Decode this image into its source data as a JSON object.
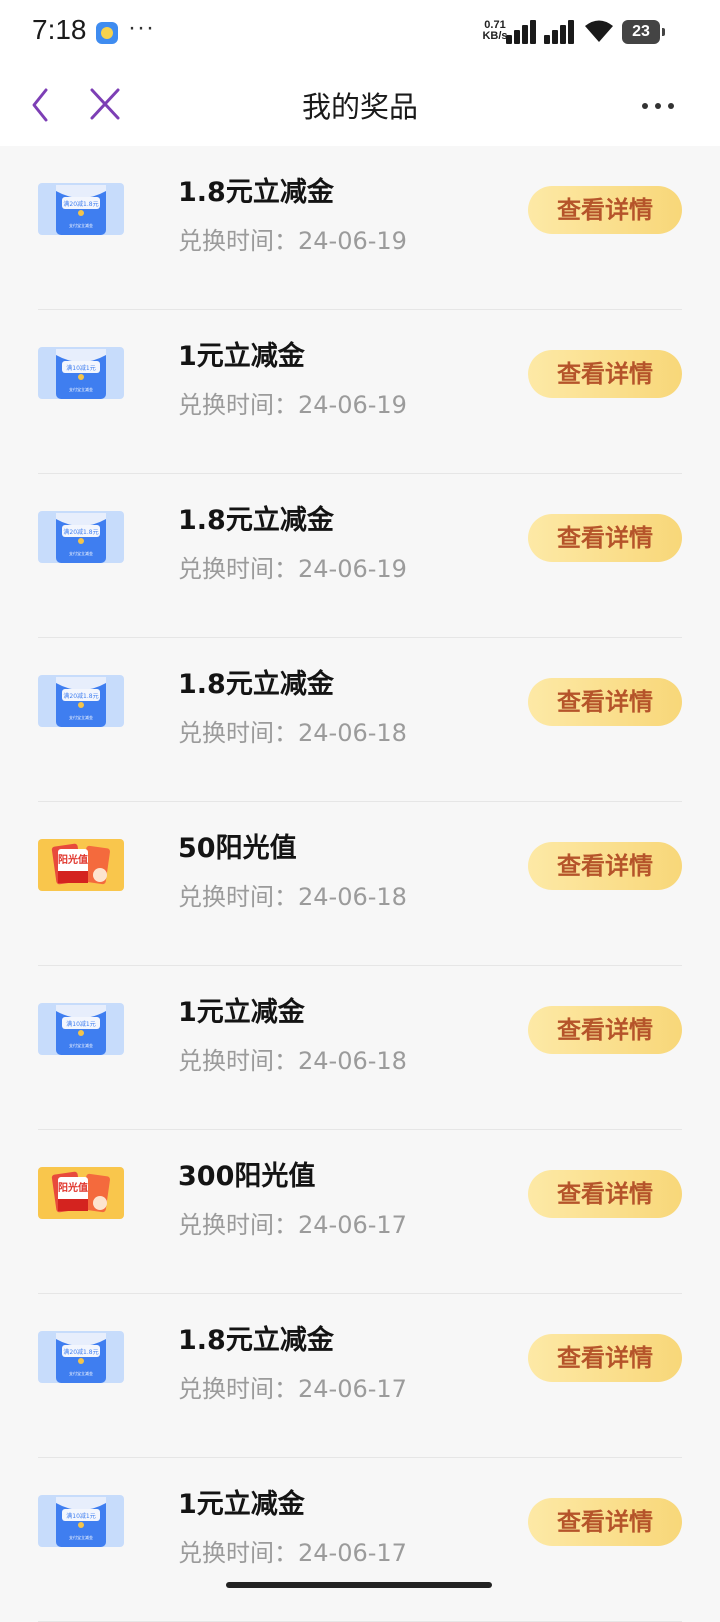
{
  "status_bar": {
    "time": "7:18",
    "dots": "···",
    "speed_value": "0.71",
    "speed_unit": "KB/s",
    "battery": "23"
  },
  "nav": {
    "title": "我的奖品",
    "back_icon": "chevron-left-icon",
    "close_icon": "close-icon",
    "more_icon": "more-dots-icon",
    "accent_color": "#7d3fb5"
  },
  "prizes": [
    {
      "title": "1.8元立减金",
      "date_label": "兑换时间：",
      "date": "24-06-19",
      "button": "查看详情",
      "type": "discount-voucher"
    },
    {
      "title": "1元立减金",
      "date_label": "兑换时间：",
      "date": "24-06-19",
      "button": "查看详情",
      "type": "discount-voucher"
    },
    {
      "title": "1.8元立减金",
      "date_label": "兑换时间：",
      "date": "24-06-19",
      "button": "查看详情",
      "type": "discount-voucher"
    },
    {
      "title": "1.8元立减金",
      "date_label": "兑换时间：",
      "date": "24-06-18",
      "button": "查看详情",
      "type": "discount-voucher"
    },
    {
      "title": "50阳光值",
      "date_label": "兑换时间：",
      "date": "24-06-18",
      "button": "查看详情",
      "type": "sunshine-points"
    },
    {
      "title": "1元立减金",
      "date_label": "兑换时间：",
      "date": "24-06-18",
      "button": "查看详情",
      "type": "discount-voucher"
    },
    {
      "title": "300阳光值",
      "date_label": "兑换时间：",
      "date": "24-06-17",
      "button": "查看详情",
      "type": "sunshine-points"
    },
    {
      "title": "1.8元立减金",
      "date_label": "兑换时间：",
      "date": "24-06-17",
      "button": "查看详情",
      "type": "discount-voucher"
    },
    {
      "title": "1元立减金",
      "date_label": "兑换时间：",
      "date": "24-06-17",
      "button": "查看详情",
      "type": "discount-voucher"
    }
  ],
  "thumbnails": {
    "voucher_badge_a": "满20减1.8元",
    "voucher_badge_b": "满10减1元",
    "voucher_footer": "支付宝立减金",
    "sunshine_label": "阳光值"
  },
  "colors": {
    "button_text": "#b5542a",
    "button_bg_start": "#fde9a6",
    "button_bg_end": "#f8d779",
    "date_text": "#9b9b9b",
    "voucher_blue": "#3f7ef0",
    "sunshine_orange": "#f9c64c"
  }
}
